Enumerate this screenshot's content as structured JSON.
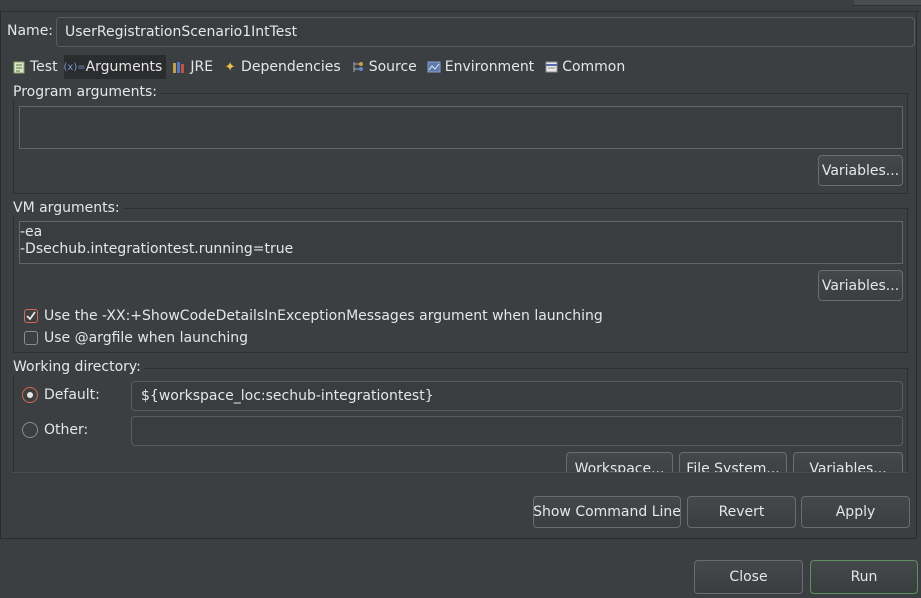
{
  "name": {
    "label": "Name:",
    "value": "UserRegistrationScenario1IntTest"
  },
  "tabs": [
    {
      "label": "Test",
      "icon": "test-icon",
      "active": false
    },
    {
      "label": "Arguments",
      "icon": "arguments-icon",
      "active": true
    },
    {
      "label": "JRE",
      "icon": "jre-icon",
      "active": false
    },
    {
      "label": "Dependencies",
      "icon": "dependencies-icon",
      "active": false
    },
    {
      "label": "Source",
      "icon": "source-icon",
      "active": false
    },
    {
      "label": "Environment",
      "icon": "environment-icon",
      "active": false
    },
    {
      "label": "Common",
      "icon": "common-icon",
      "active": false
    }
  ],
  "program_args": {
    "legend": "Program arguments:",
    "value": "",
    "variables_label": "Variables..."
  },
  "vm_args": {
    "legend": "VM arguments:",
    "line1": "-ea",
    "line2": "-Dsechub.integrationtest.running=true",
    "variables_label": "Variables...",
    "show_code_details": {
      "label": "Use the -XX:+ShowCodeDetailsInExceptionMessages argument when launching",
      "checked": true
    },
    "argfile": {
      "label": "Use @argfile when launching",
      "checked": false
    }
  },
  "working_dir": {
    "legend": "Working directory:",
    "default_label": "Default:",
    "default_value": "${workspace_loc:sechub-integrationtest}",
    "other_label": "Other:",
    "other_value": "",
    "selected": "default",
    "workspace_label": "Workspace...",
    "filesystem_label": "File System...",
    "variables_label": "Variables..."
  },
  "actions": {
    "show_command_line": "Show Command Line",
    "revert": "Revert",
    "apply": "Apply"
  },
  "footer": {
    "close": "Close",
    "run": "Run"
  },
  "colors": {
    "background": "#3c3f41",
    "check_accent": "#d86a4a",
    "run_border": "#5f8f5f"
  }
}
